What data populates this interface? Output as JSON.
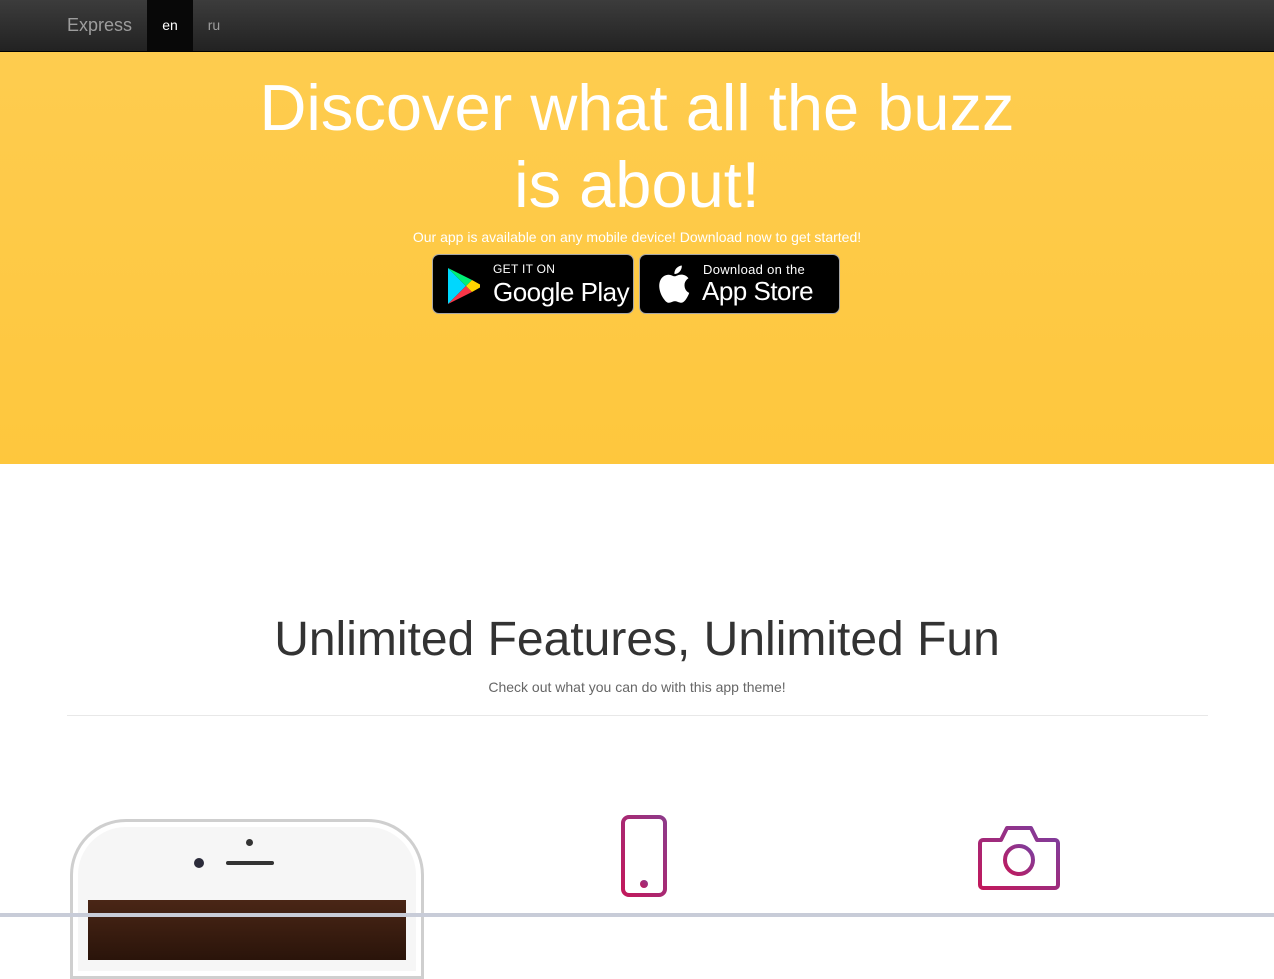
{
  "navbar": {
    "brand": "Express",
    "languages": [
      {
        "label": "en",
        "active": true
      },
      {
        "label": "ru",
        "active": false
      }
    ]
  },
  "hero": {
    "title": "Discover what all the buzz is about!",
    "subtitle": "Our app is available on any mobile device! Download now to get started!",
    "google_play": {
      "small": "GET IT ON",
      "big": "Google Play",
      "icon": "google-play-icon"
    },
    "app_store": {
      "small": "Download on the",
      "big": "App Store",
      "icon": "apple-icon"
    },
    "background_color": "#fec845"
  },
  "features": {
    "title": "Unlimited Features, Unlimited Fun",
    "subtitle": "Check out what you can do with this app theme!",
    "icons": [
      "smartphone-icon",
      "camera-icon"
    ],
    "icon_gradient": [
      "#c2185b",
      "#7b3fa0"
    ]
  }
}
